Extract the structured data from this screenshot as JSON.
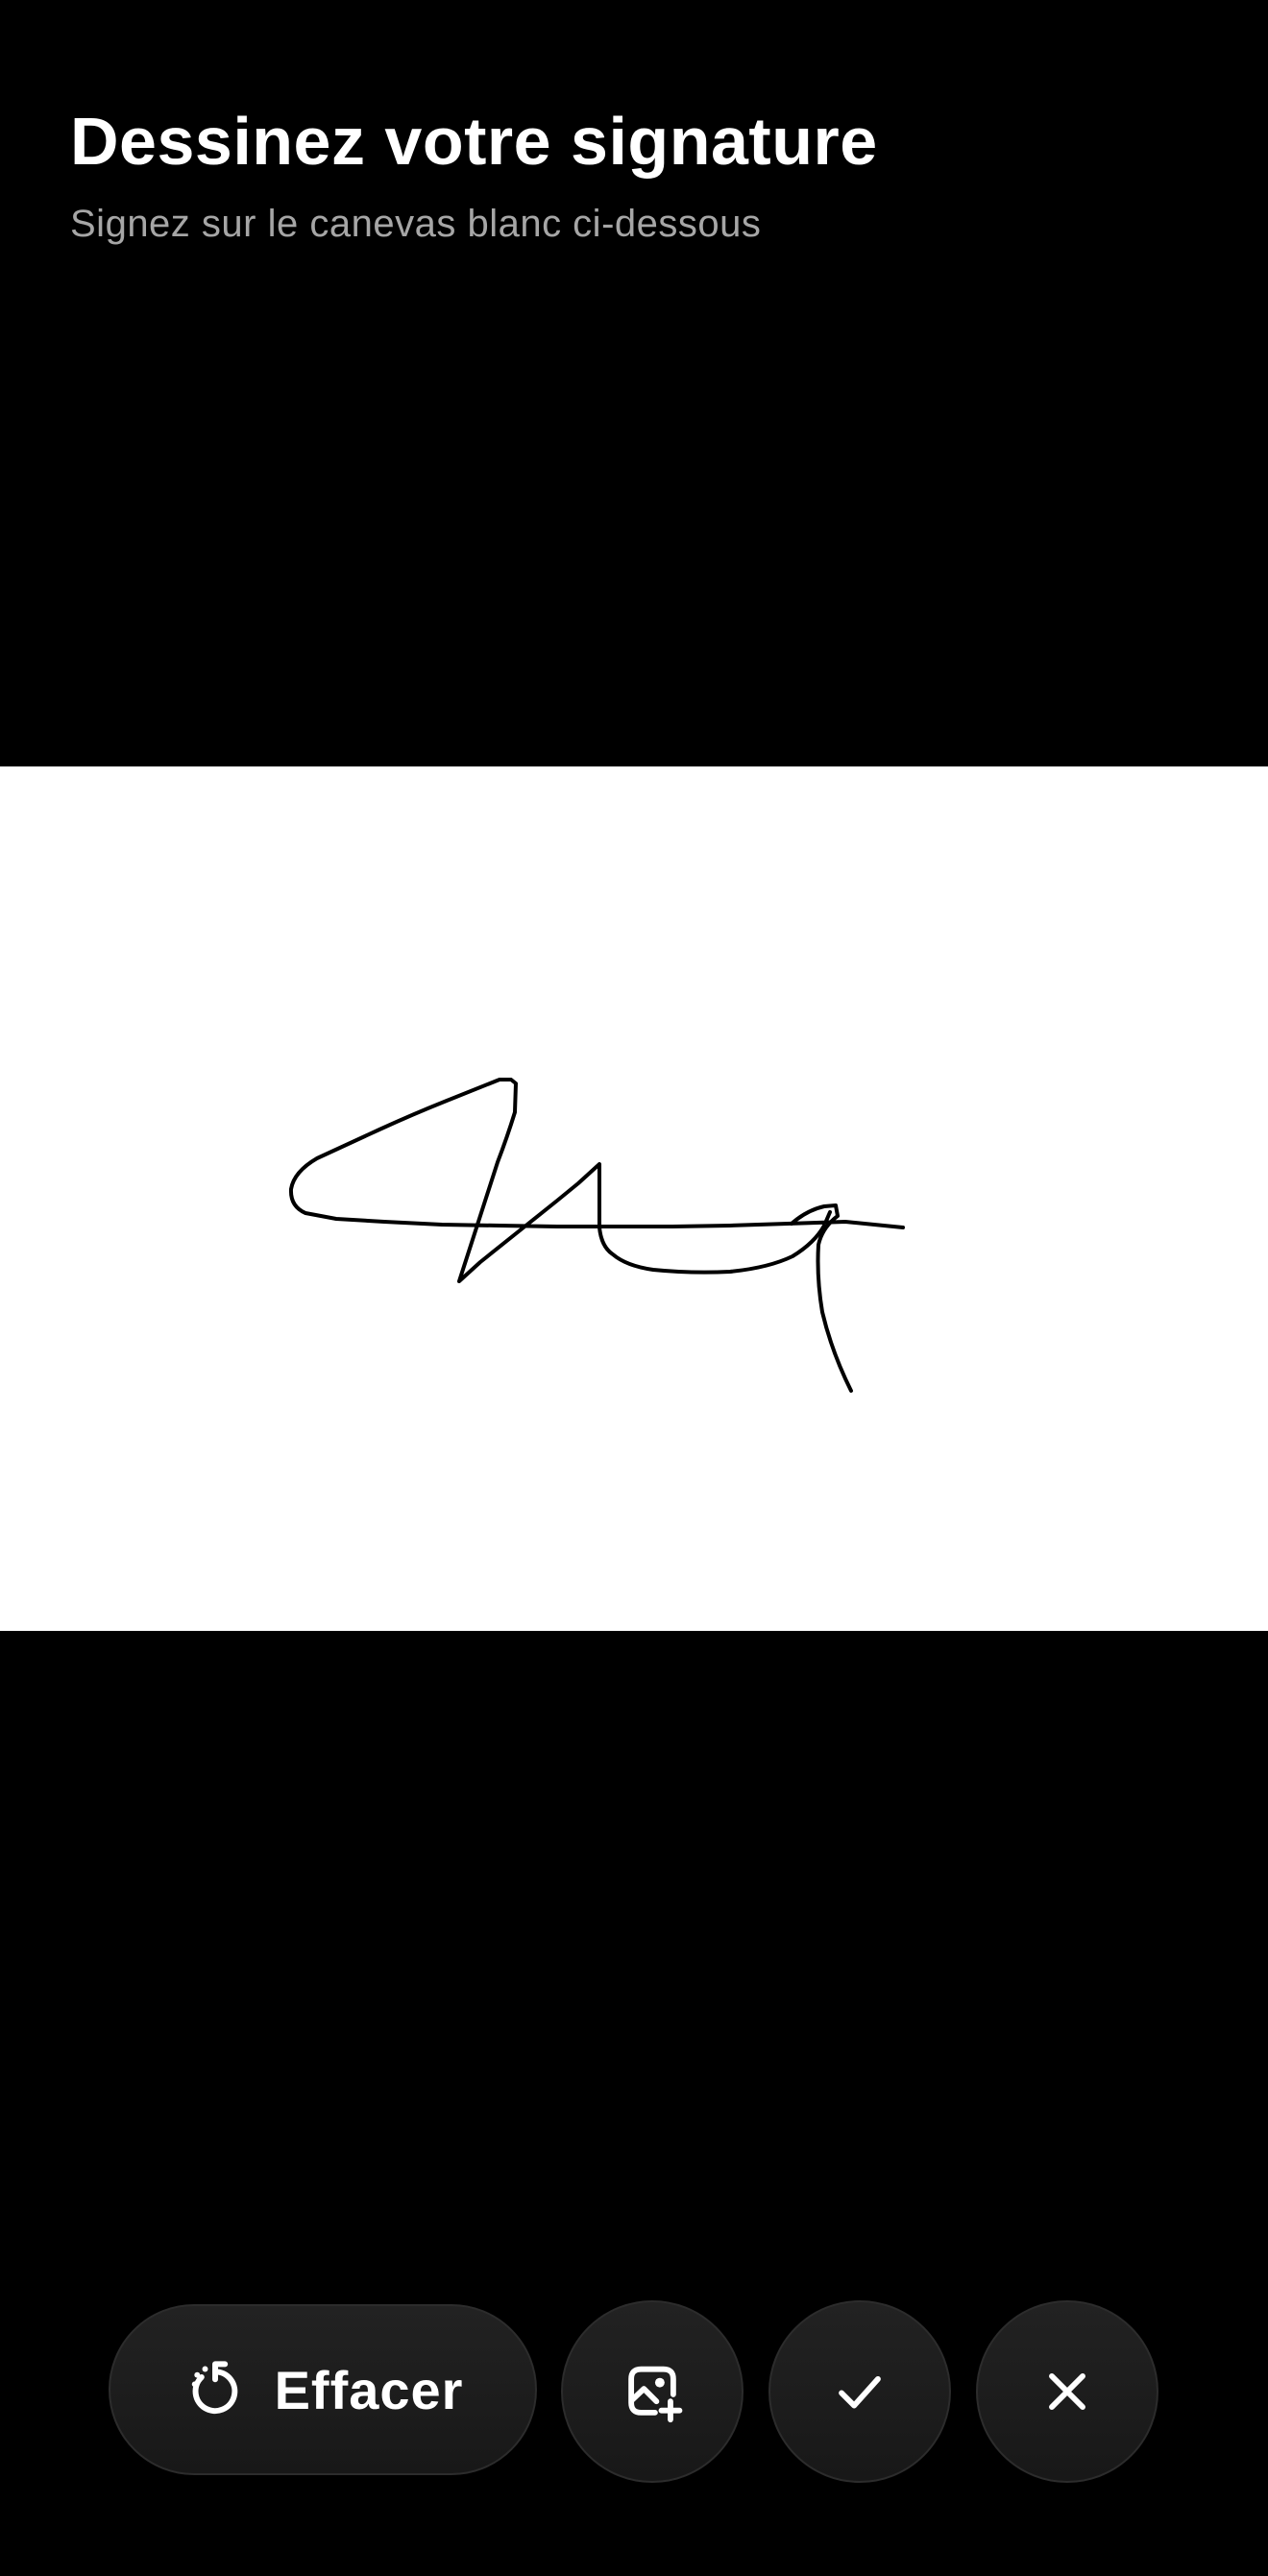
{
  "header": {
    "title": "Dessinez votre signature",
    "subtitle": "Signez sur le canevas blanc ci-dessous"
  },
  "canvas": {
    "background": "#ffffff",
    "ink_color": "#000000",
    "has_signature": true
  },
  "toolbar": {
    "clear_label": "Effacer",
    "clear_icon": "rotate-ccw-icon",
    "image_icon": "image-plus-icon",
    "confirm_icon": "check-icon",
    "cancel_icon": "close-icon"
  },
  "colors": {
    "background": "#000000",
    "title": "#ffffff",
    "subtitle": "#a6a6a6",
    "button": "#1c1c1c"
  }
}
